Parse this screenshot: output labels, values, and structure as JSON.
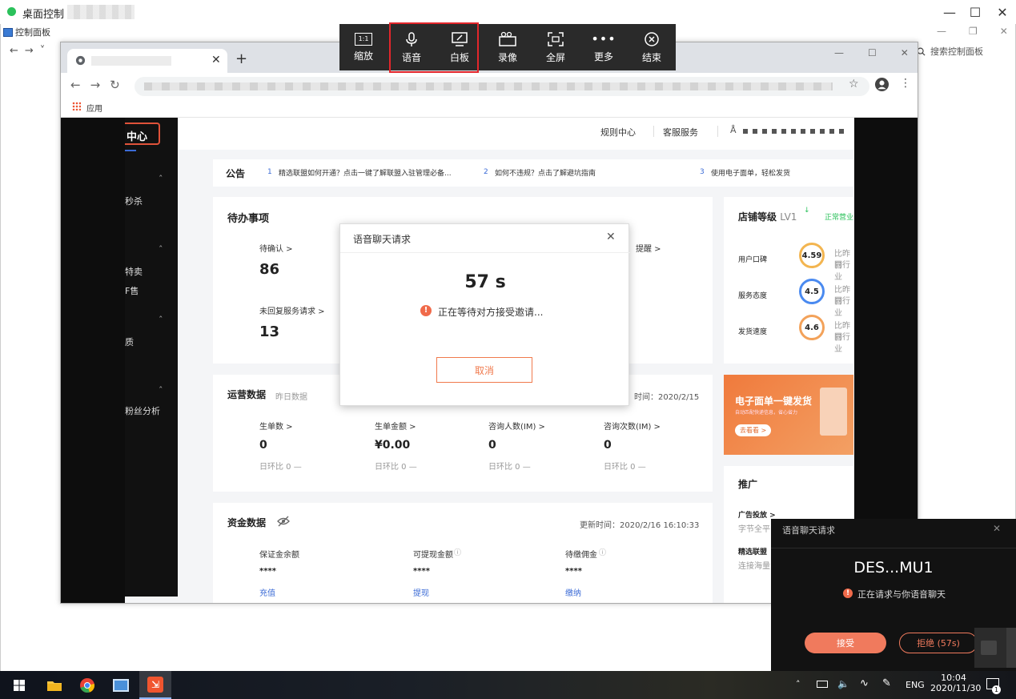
{
  "window": {
    "title": "桌面控制"
  },
  "toolbar": {
    "items": [
      {
        "label": "缩放",
        "icon": "zoom-ratio-icon"
      },
      {
        "label": "语音",
        "icon": "microphone-icon"
      },
      {
        "label": "白板",
        "icon": "whiteboard-icon"
      },
      {
        "label": "录像",
        "icon": "video-camera-icon"
      },
      {
        "label": "全屏",
        "icon": "fullscreen-icon"
      },
      {
        "label": "更多",
        "icon": "more-icon"
      },
      {
        "label": "结束",
        "icon": "end-icon"
      }
    ],
    "zoom_glyph": "1:1"
  },
  "control_panel": {
    "title": "控制面板",
    "search_placeholder": "搜索控制面板"
  },
  "browser": {
    "bookmark": "应用"
  },
  "page": {
    "sidebar": {
      "active": "中心",
      "items": [
        "秒杀",
        "特卖",
        "F售",
        "质",
        "粉丝分析"
      ]
    },
    "header": {
      "links": [
        "规则中心",
        "客服服务"
      ]
    },
    "notice": {
      "label": "公告",
      "items": [
        {
          "num": "1",
          "text": "精选联盟如何开通？点击一键了解联盟入驻管理必备..."
        },
        {
          "num": "2",
          "text": "如何不违规？点击了解避坑指南"
        },
        {
          "num": "3",
          "text": "使用电子面单，轻松发货"
        }
      ]
    },
    "todo": {
      "title": "待办事项",
      "items": [
        {
          "label": "待确认 >",
          "value": "86"
        },
        {
          "label": "未回复服务请求 >",
          "value": "13"
        }
      ],
      "extra_label": "提醒 >"
    },
    "store": {
      "title": "店铺等级",
      "level": "LV1",
      "status": "正常营业",
      "metrics": [
        {
          "label": "用户口碑",
          "score": "4.59",
          "cmp1": "比昨日",
          "cmp2": "同行业"
        },
        {
          "label": "服务态度",
          "score": "4.5",
          "cmp1": "比昨日",
          "cmp2": "同行业"
        },
        {
          "label": "发货速度",
          "score": "4.6",
          "cmp1": "比昨日",
          "cmp2": "同行业"
        }
      ]
    },
    "ops": {
      "title": "运营数据",
      "subtitle": "昨日数据",
      "updated": "时间：2020/2/15",
      "metrics": [
        {
          "label": "生单数 >",
          "value": "0",
          "change": "日环比 0 —"
        },
        {
          "label": "生单金额 >",
          "value": "¥0.00",
          "change": "日环比 0 —"
        },
        {
          "label": "咨询人数(IM) >",
          "value": "0",
          "change": "日环比 0 —"
        },
        {
          "label": "咨询次数(IM) >",
          "value": "0",
          "change": "日环比 0 —"
        }
      ]
    },
    "banner": {
      "title": "电子面单一键发货",
      "sub": "自动匹配快递信息，省心省力",
      "button": "去看看 >"
    },
    "funds": {
      "title": "资金数据",
      "updated": "更新时间：2020/2/16 16:10:33",
      "items": [
        {
          "label": "保证金余额",
          "value": "****",
          "action": "充值"
        },
        {
          "label": "可提现金额",
          "value": "****",
          "action": "提现"
        },
        {
          "label": "待缴佣金",
          "value": "****",
          "action": "缴纳"
        }
      ]
    },
    "promo": {
      "title": "推广",
      "items": [
        {
          "title": "广告投放 >",
          "sub": "字节全平"
        },
        {
          "title": "精选联盟",
          "sub": "连接海量"
        }
      ]
    }
  },
  "modal": {
    "title": "语音聊天请求",
    "timer": "57 s",
    "message": "正在等待对方接受邀请...",
    "cancel": "取消"
  },
  "popup": {
    "title": "语音聊天请求",
    "device": "DES...MU1",
    "message": "正在请求与你语音聊天",
    "accept": "接受",
    "reject": "拒绝 (57s)"
  },
  "taskbar": {
    "tray_lang": "ENG",
    "time": "10:04",
    "date": "2020/11/30",
    "notification_count": "1"
  },
  "colors": {
    "accent": "#f07a4d",
    "toolbar_bg": "#2a2a2a",
    "highlight": "#e3262b",
    "link": "#3b6bd6",
    "green": "#2bc15b"
  }
}
